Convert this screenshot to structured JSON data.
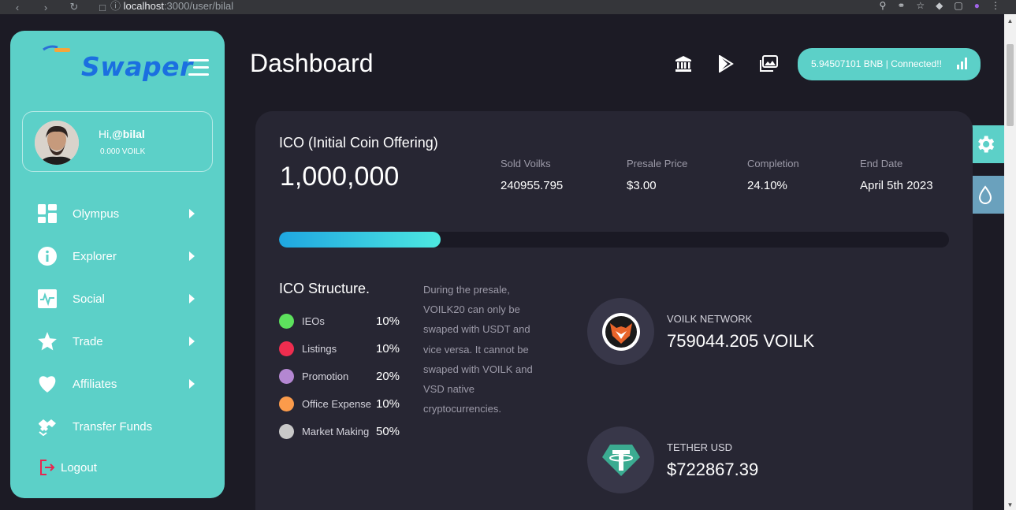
{
  "browser": {
    "url_host": "localhost",
    "url_rest": ":3000/user/bilal"
  },
  "sidebar": {
    "logo_text": "Swaper",
    "greeting_prefix": "Hi,",
    "username": "@bilal",
    "balance": "0.000 VOILK",
    "items": [
      {
        "label": "Olympus",
        "icon": "dashboard-grid-icon",
        "has_submenu": true
      },
      {
        "label": "Explorer",
        "icon": "info-icon",
        "has_submenu": true
      },
      {
        "label": "Social",
        "icon": "activity-wave-icon",
        "has_submenu": true
      },
      {
        "label": "Trade",
        "icon": "star-icon",
        "has_submenu": true
      },
      {
        "label": "Affiliates",
        "icon": "heart-icon",
        "has_submenu": true
      },
      {
        "label": "Transfer Funds",
        "icon": "handshake-icon",
        "has_submenu": false
      }
    ],
    "logout_label": "Logout"
  },
  "header": {
    "title": "Dashboard",
    "icons": [
      "bank-icon",
      "play-store-icon",
      "gallery-icon"
    ],
    "wallet_status": "5.94507101 BNB | Connected!!"
  },
  "ico": {
    "title": "ICO (Initial Coin Offering)",
    "total": "1,000,000",
    "stats": [
      {
        "label": "Sold Voilks",
        "value": "240955.795"
      },
      {
        "label": "Presale Price",
        "value": "$3.00"
      },
      {
        "label": "Completion",
        "value": "24.10%"
      },
      {
        "label": "End Date",
        "value": "April 5th 2023"
      }
    ],
    "progress_fraction": 0.241
  },
  "structure": {
    "title": "ICO Structure.",
    "items": [
      {
        "name": "IEOs",
        "pct": "10%",
        "color": "#5de15d"
      },
      {
        "name": "Listings",
        "pct": "10%",
        "color": "#ef2d4f"
      },
      {
        "name": "Promotion",
        "pct": "20%",
        "color": "#b487d2"
      },
      {
        "name": "Office Expense",
        "pct": "10%",
        "color": "#fb9b4b"
      },
      {
        "name": "Market Making",
        "pct": "50%",
        "color": "#c8c8c8"
      }
    ],
    "description": "During the presale, VOILK20 can only be swaped with USDT and vice versa. It cannot be swaped with VOILK and VSD native cryptocurrencies."
  },
  "tokens": [
    {
      "name": "VOILK NETWORK",
      "value": "759044.205 VOILK",
      "icon": "voilk-fox-icon"
    },
    {
      "name": "TETHER USD",
      "value": "$722867.39",
      "icon": "tether-icon"
    }
  ],
  "colors": {
    "accent": "#5cd0c8",
    "background": "#1c1b25",
    "card": "#272633",
    "drop_button": "#6aa1bd"
  }
}
